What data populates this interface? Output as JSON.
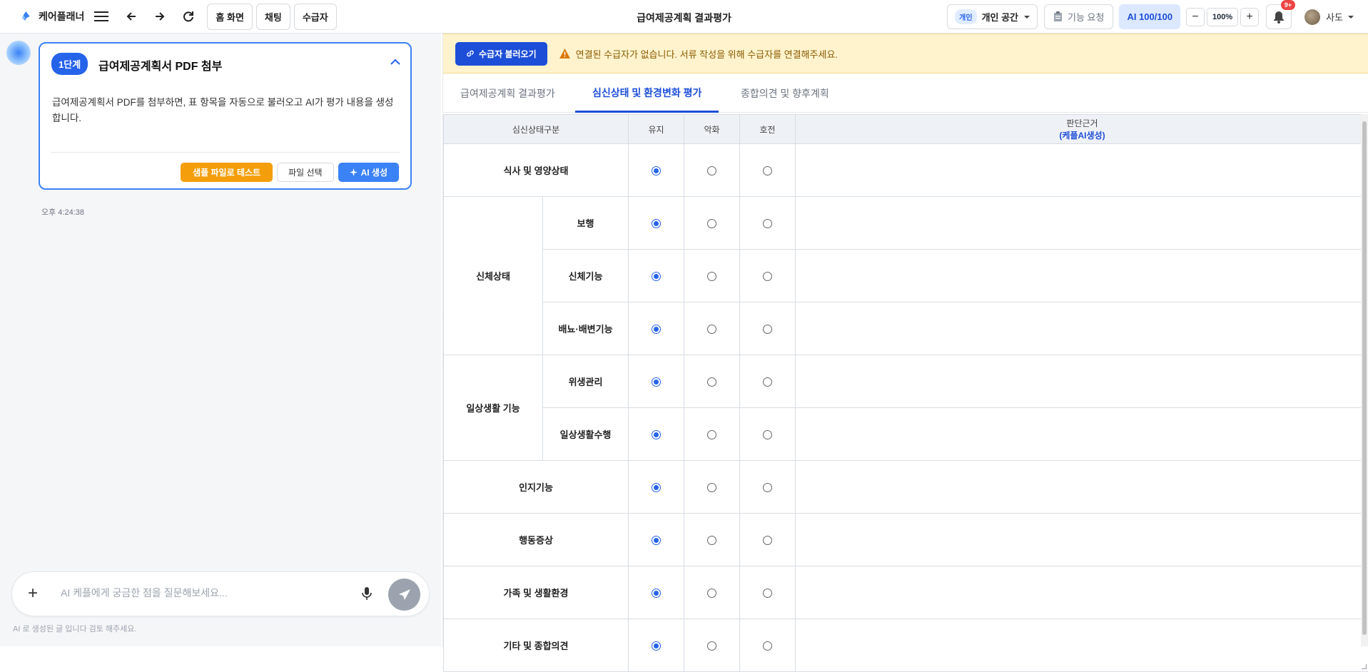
{
  "brand": {
    "name": "케어플래너"
  },
  "nav": {
    "home": "홈 화면",
    "chat": "채팅",
    "recipient": "수급자"
  },
  "page_title": "급여제공계획 결과평가",
  "workspace": {
    "tag": "개인",
    "label": "개인 공간"
  },
  "feature_request": "기능 요청",
  "ai_quota": "AI 100/100",
  "zoom": {
    "minus": "−",
    "value": "100%",
    "plus": "+"
  },
  "notifications": {
    "count": "9+"
  },
  "user": {
    "name": "사도"
  },
  "card": {
    "step": "1단계",
    "title": "급여제공계획서 PDF 첨부",
    "description": "급여제공계획서 PDF를 첨부하면, 표 항목을 자동으로 불러오고 AI가 평가 내용을 생성합니다.",
    "btn_sample": "샘플 파일로 테스트",
    "btn_file": "파일 선택",
    "btn_ai": "AI 생성"
  },
  "message_time": "오후 4:24:38",
  "chat_input": {
    "placeholder": "AI 케플에게 궁금한 점을 질문해보세요..."
  },
  "disclaimer": "AI 로 생성된 글 입니다 검토 해주세요.",
  "banner": {
    "button": "수급자 불러오기",
    "text": "연결된 수급자가 없습니다. 서류 작성을 위해 수급자를 연결해주세요."
  },
  "tabs": [
    {
      "label": "급여제공계획 결과평가",
      "active": false
    },
    {
      "label": "심신상태 및 환경변화 평가",
      "active": true
    },
    {
      "label": "종합의견 및 향후계획",
      "active": false
    }
  ],
  "table": {
    "headers": {
      "category": "심신상태구분",
      "keep": "유지",
      "worse": "악화",
      "better": "호전",
      "basis": "판단근거",
      "basis_sub": "(케플AI생성)"
    },
    "groups": {
      "body": "신체상태",
      "daily": "일상생활 기능"
    },
    "rows": [
      {
        "label": "식사 및 영양상태",
        "selected": "keep"
      },
      {
        "label": "보행",
        "selected": "keep"
      },
      {
        "label": "신체기능",
        "selected": "keep"
      },
      {
        "label": "배뇨·배변기능",
        "selected": "keep"
      },
      {
        "label": "위생관리",
        "selected": "keep"
      },
      {
        "label": "일상생활수행",
        "selected": "keep"
      },
      {
        "label": "인지기능",
        "selected": "keep"
      },
      {
        "label": "행동증상",
        "selected": "keep"
      },
      {
        "label": "가족 및 생활환경",
        "selected": "keep"
      },
      {
        "label": "기타 및 종합의견",
        "selected": "keep"
      }
    ]
  },
  "colors": {
    "primary": "#2563eb",
    "accent_orange": "#f59e0b",
    "banner_bg": "#fff3cd"
  }
}
